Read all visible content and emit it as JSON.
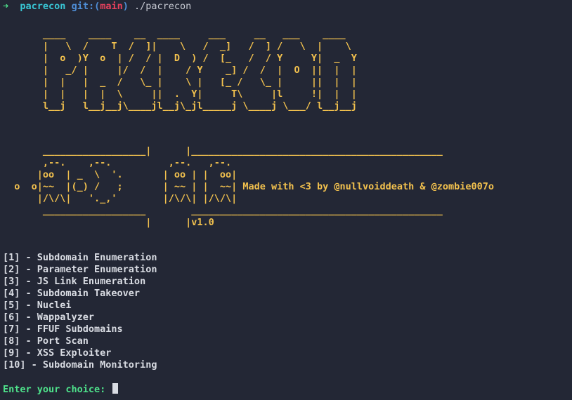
{
  "prompt": {
    "arrow": "➜",
    "directory": "pacrecon",
    "git_prefix": "git:(",
    "branch": "main",
    "git_suffix": ")",
    "command": "./pacrecon"
  },
  "banner_art": "       ____    ____    __  ____     ___     __   ___    ____\n       |   \\  /    T  /  ]|    \\   /  _]   /  ] /   \\  |    \\\n       |  o  )Y  o  | /  / |  D  ) /  [_   /  / Y     Y|  _  Y\n       |   _/ |     |/  /  |    / Y    _] /  /  |  O  ||  |  |\n       |  |   |  _  /   \\_ |    \\ |   [_ /   \\_ |     ||  |  |\n       |  |   |  |  \\     ||  .  Y|     T\\     |l     !|  |  |\n       l__j   l__j__j\\____jl__j\\_jl_____j \\____j \\___/ l__j__j",
  "logo_art": "       __________________|      |____________________________________________\n       ,--.    ,--.          ,--.   ,--.\n      |oo  | _  \\  '.       | oo | |  oo|\n  o  o|~~  |(_) /   ;       | ~~ | |  ~~|\n      |/\\/\\|   '._,'        |/\\/\\| |/\\/\\|\n       __________________        ____________________________________________\n                         |      |",
  "credit_text": "Made with <3 by @nullvoiddeath & @zombie007o",
  "version": "v1.0",
  "menu": [
    "[1] - Subdomain Enumeration",
    "[2] - Parameter Enumeration",
    "[3] - JS Link Enumeration",
    "[4] - Subdomain Takeover",
    "[5] - Nuclei",
    "[6] - Wappalyzer",
    "[7] - FFUF Subdomains",
    "[8] - Port Scan",
    "[9] - XSS Exploiter",
    "[10] - Subdomain Monitoring"
  ],
  "input_prompt": "Enter your choice: ",
  "colors": {
    "background": "#232735",
    "banner": "#f2c14e",
    "prompt_green": "#4ee28b",
    "directory_cyan": "#38c7d6",
    "git_blue": "#4f8fd8",
    "branch_red": "#e8415d"
  }
}
